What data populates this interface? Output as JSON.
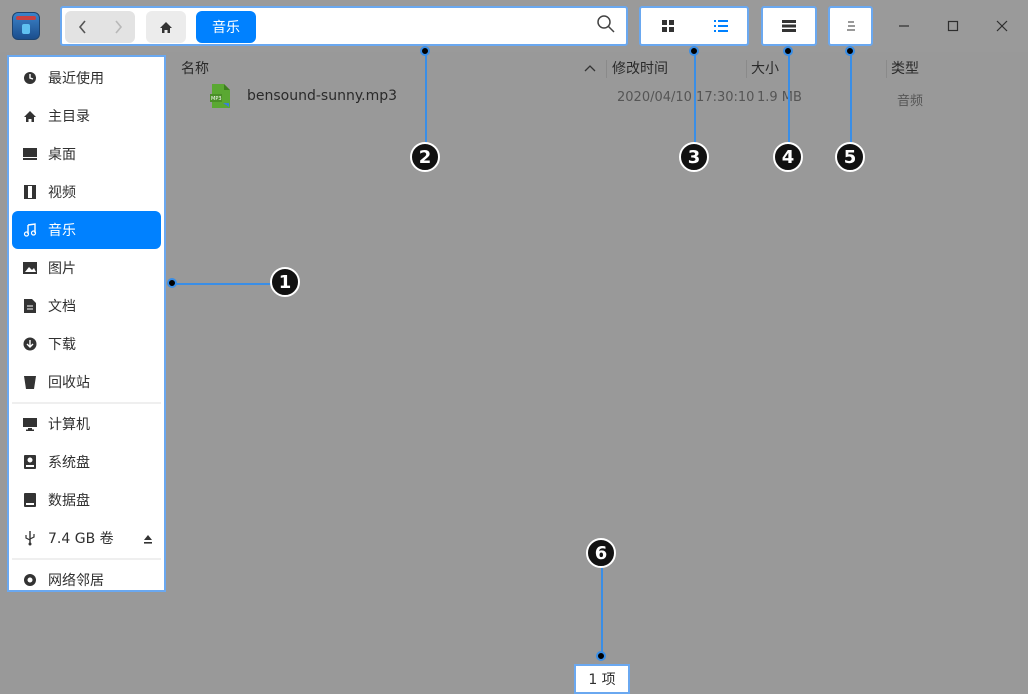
{
  "window": {
    "controls": {
      "minimize_icon": "minimize-icon",
      "maximize_icon": "maximize-icon",
      "close_icon": "close-icon"
    }
  },
  "address_bar": {
    "back_icon": "chevron-left-icon",
    "forward_icon": "chevron-right-icon",
    "home_icon": "home-icon",
    "breadcrumb": "音乐",
    "search_icon": "search-icon"
  },
  "sidebar": {
    "items": [
      {
        "label": "最近使用",
        "icon": "clock-icon"
      },
      {
        "label": "主目录",
        "icon": "home-icon"
      },
      {
        "label": "桌面",
        "icon": "desktop-icon"
      },
      {
        "label": "视频",
        "icon": "video-icon"
      },
      {
        "label": "音乐",
        "icon": "music-icon",
        "active": true
      },
      {
        "label": "图片",
        "icon": "picture-icon"
      },
      {
        "label": "文档",
        "icon": "document-icon"
      },
      {
        "label": "下载",
        "icon": "download-icon"
      },
      {
        "label": "回收站",
        "icon": "trash-icon"
      }
    ],
    "devices": [
      {
        "label": "计算机",
        "icon": "computer-icon"
      },
      {
        "label": "系统盘",
        "icon": "system-disk-icon"
      },
      {
        "label": "数据盘",
        "icon": "disk-icon"
      },
      {
        "label": "7.4 GB 卷",
        "icon": "usb-icon"
      }
    ],
    "network": [
      {
        "label": "网络邻居",
        "icon": "network-icon"
      }
    ]
  },
  "columns": {
    "name": "名称",
    "modified": "修改时间",
    "size": "大小",
    "type": "类型"
  },
  "files": [
    {
      "name": "bensound-sunny.mp3",
      "modified": "2020/04/10 17:30:10",
      "size": "1.9 MB",
      "type": "音频"
    }
  ],
  "status": {
    "count": "1 项"
  },
  "callouts": [
    "1",
    "2",
    "3",
    "4",
    "5",
    "6"
  ],
  "colors": {
    "accent": "#0081ff",
    "highlight": "#3a8ee6"
  }
}
